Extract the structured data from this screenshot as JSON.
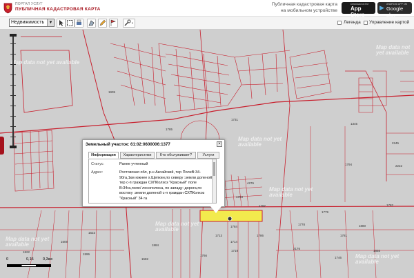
{
  "header": {
    "portal_label": "ПОРТАЛ УСЛУГ",
    "portal_title": "ПУБЛИЧНАЯ КАДАСТРОВАЯ КАРТА",
    "mobile_text": "Публичная кадастровая карта на мобильном устройстве",
    "app_store_small": "Download on the",
    "app_store_label": "App Store",
    "google_small": "ANDROID APP ON",
    "google_label": "Google play"
  },
  "toolbar": {
    "layer_select": "Недвижимость",
    "legend_label": "Легенда",
    "map_control_label": "Управление картой"
  },
  "map": {
    "nodata_text": "Map data not yet available",
    "parcel_numbers": [
      "1905",
      "1785",
      "1345",
      "1794",
      "4276",
      "1793",
      "1797",
      "2245",
      "2222",
      "1713",
      "1778",
      "1782",
      "1779",
      "1781",
      "1786",
      "1784",
      "1714",
      "1609",
      "1623",
      "1596",
      "1582",
      "1884",
      "1766",
      "2176",
      "1731",
      "1719",
      "1746",
      "1822",
      "1880",
      "1855",
      "1610"
    ],
    "scale_left": "0",
    "scale_mid": "0,15",
    "scale_right": "0,3км"
  },
  "popup": {
    "title": "Земельный участок: 61:02:0600006:1377",
    "close": "×",
    "tabs": [
      "Информация",
      "Характеристики",
      "Кто обслуживает?",
      "Услуги"
    ],
    "status_label": "Статус:",
    "status_value": "Ранее учтенный",
    "address_label": "Адрес:",
    "address_value": "Ростовская обл, р-н Аксайский, тер ПолеВ:34-90га,1км южнее х.Щепкин,по северу :земли доленой, тер с-п граждан СХПКолхоз \"Красный\" поле В:34га,поле/ лесополоса, по западу: дорога,по востоку :земли доленой с-п граждан СХПКолхоз \"Красный\" 34 га"
  },
  "colors": {
    "brand": "#a5121c",
    "parcel_line": "#c81e2c",
    "highlight": "#f2ea4d"
  }
}
